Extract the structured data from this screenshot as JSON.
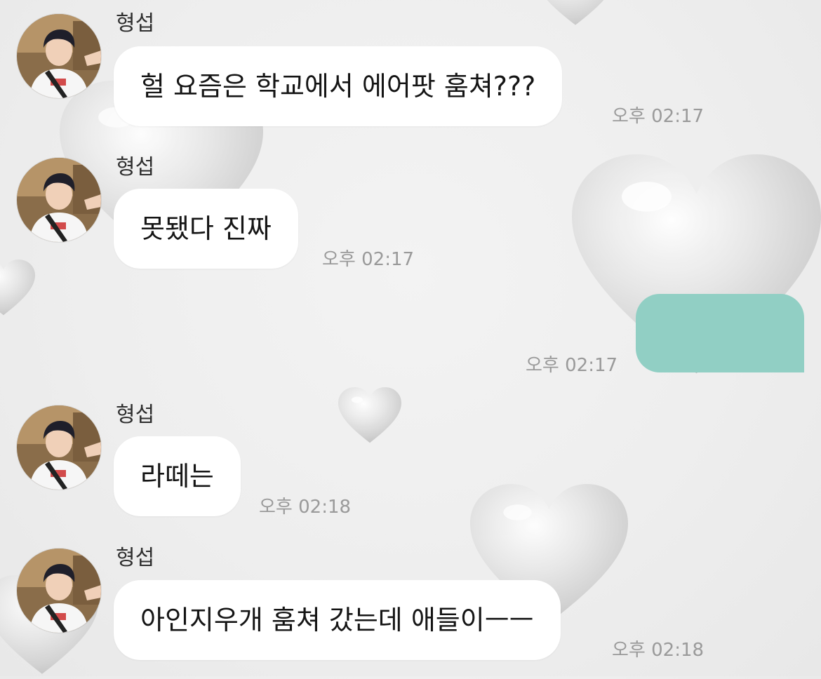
{
  "colors": {
    "background": "#eeeeee",
    "bubble_incoming": "#ffffff",
    "bubble_outgoing": "#91cfc4",
    "timestamp": "#9a9a9a"
  },
  "messages": [
    {
      "sender": "형섭",
      "text": "헐 요즘은 학교에서 에어팟 훔쳐???",
      "time": "오후 02:17",
      "direction": "incoming",
      "avatar": "avatar-photo"
    },
    {
      "sender": "형섭",
      "text": "못됐다 진짜",
      "time": "오후 02:17",
      "direction": "incoming",
      "avatar": "avatar-photo"
    },
    {
      "text": "",
      "time": "오후 02:17",
      "direction": "outgoing",
      "redacted": true
    },
    {
      "sender": "형섭",
      "text": "라떼는",
      "time": "오후 02:18",
      "direction": "incoming",
      "avatar": "avatar-photo"
    },
    {
      "sender": "형섭",
      "text": "아인지우개 훔쳐 갔는데 애들이ㅡㅡ",
      "time": "오후 02:18",
      "direction": "incoming",
      "avatar": "avatar-photo"
    }
  ]
}
